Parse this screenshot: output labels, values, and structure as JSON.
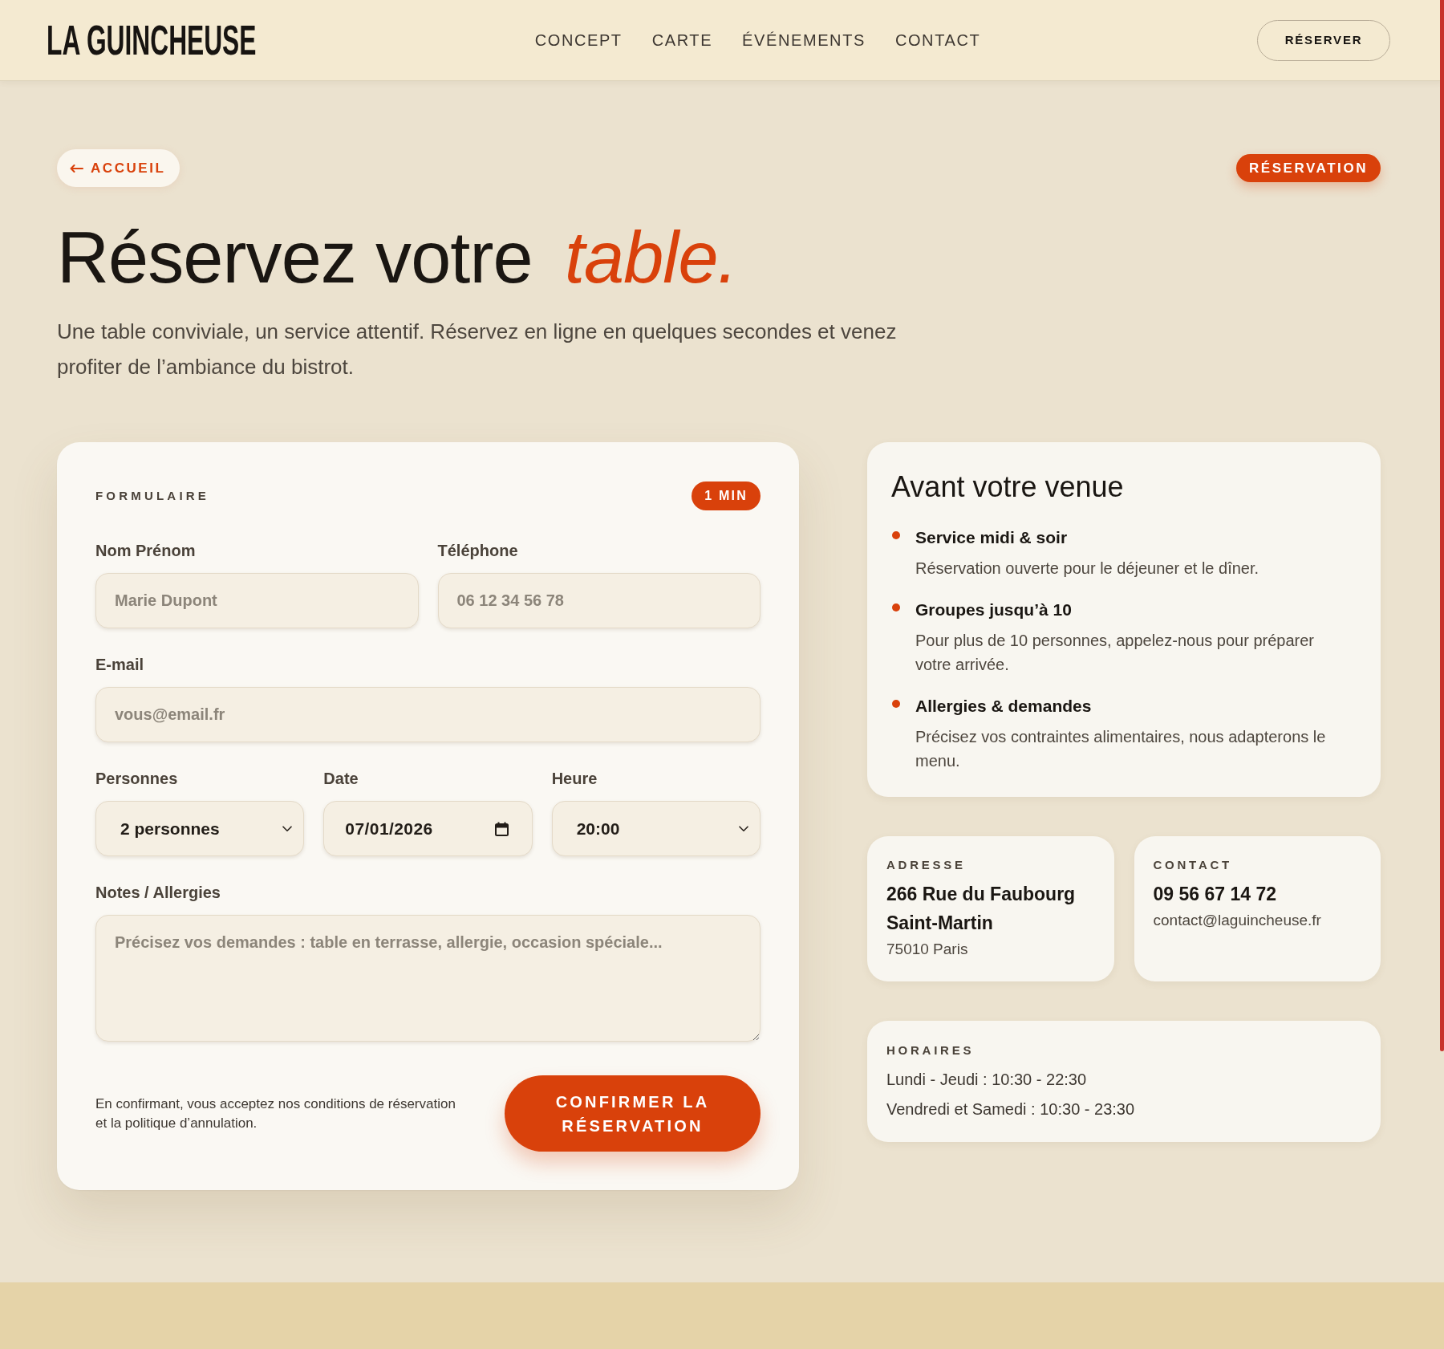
{
  "header": {
    "logo": "LA GUINCHEUSE",
    "nav": [
      "CONCEPT",
      "CARTE",
      "ÉVÉNEMENTS",
      "CONTACT"
    ],
    "cta": "RÉSERVER"
  },
  "hero": {
    "back_link": "ACCUEIL",
    "badge": "RÉSERVATION",
    "title": "Réservez votre *table.*",
    "subtitle": "Une table conviviale, un service attentif. Réservez en ligne en quelques secondes et venez profiter de l’ambiance du bistrot."
  },
  "form": {
    "eyebrow": "FORMULAIRE",
    "badge": "1 MIN",
    "rows": [
      [
        {
          "kind": "text",
          "label": "Nom Prénom",
          "placeholder": "Marie Dupont"
        },
        {
          "kind": "text",
          "label": "Téléphone",
          "placeholder": "06 12 34 56 78"
        }
      ],
      [
        {
          "kind": "text",
          "label": "E-mail",
          "placeholder": "vous@email.fr"
        }
      ],
      [
        {
          "kind": "select",
          "label": "Personnes",
          "value": "2 personnes"
        },
        {
          "kind": "date",
          "label": "Date",
          "value": "07/01/2026"
        },
        {
          "kind": "select",
          "label": "Heure",
          "value": "20:00"
        }
      ],
      [
        {
          "kind": "textarea",
          "label": "Notes / Allergies",
          "placeholder": "Précisez vos demandes : table en terrasse, allergie, occasion spéciale..."
        }
      ]
    ],
    "terms": "En confirmant, vous acceptez nos conditions de réservation et la politique d’annulation.",
    "submit": "CONFIRMER LA RÉSERVATION"
  },
  "info": {
    "title": "Avant votre venue",
    "items": [
      {
        "title": "Service midi & soir",
        "text": "Réservation ouverte pour le déjeuner et le dîner."
      },
      {
        "title": "Groupes jusqu’à 10",
        "text": "Pour plus de 10 personnes, appelez-nous pour préparer votre arrivée."
      },
      {
        "title": "Allergies & demandes",
        "text": "Précisez vos contraintes alimentaires, nous adapterons le menu."
      }
    ]
  },
  "address": {
    "label": "ADRESSE",
    "street": "266 Rue du Faubourg Saint-Martin",
    "city": "75010 Paris"
  },
  "contact": {
    "label": "CONTACT",
    "phone": "09 56 67 14 72",
    "email": "contact@laguincheuse.fr"
  },
  "hours": {
    "label": "HORAIRES",
    "lines": [
      "Lundi - Jeudi : 10:30 - 22:30",
      "Vendredi et Samedi : 10:30 - 23:30"
    ]
  }
}
